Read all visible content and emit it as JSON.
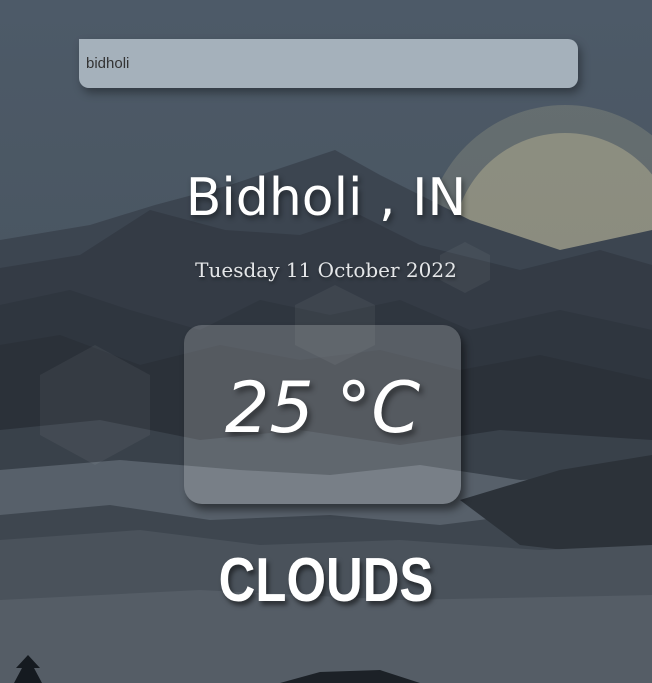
{
  "search": {
    "value": "bidholi"
  },
  "location": {
    "label": "Bidholi , IN"
  },
  "date": {
    "label": "Tuesday 11 October 2022"
  },
  "weather": {
    "temperature": "25 °C",
    "condition": "CLOUDS"
  },
  "colors": {
    "sky": "#4b5560",
    "mountain_dark": "#2a3038",
    "sun": "#d8cba0"
  }
}
